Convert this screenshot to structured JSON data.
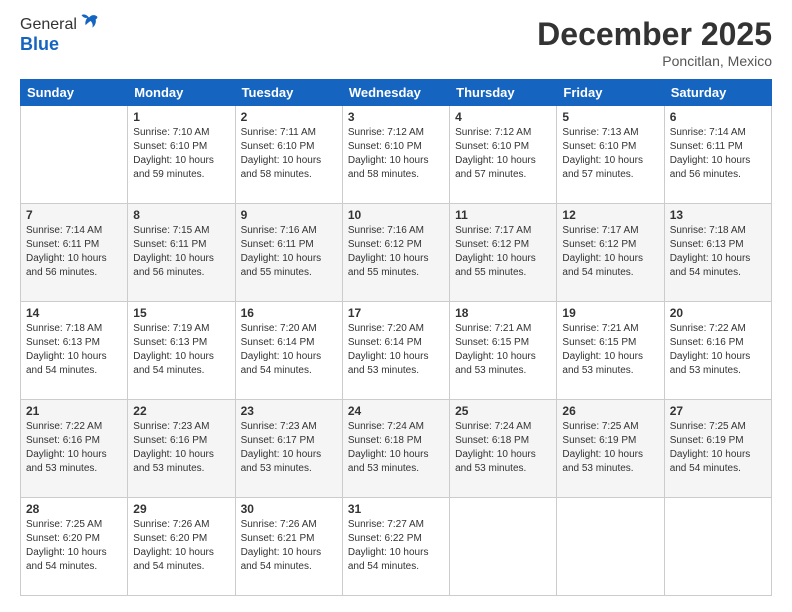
{
  "logo": {
    "general": "General",
    "blue": "Blue"
  },
  "header": {
    "month": "December 2025",
    "location": "Poncitlan, Mexico"
  },
  "days": [
    "Sunday",
    "Monday",
    "Tuesday",
    "Wednesday",
    "Thursday",
    "Friday",
    "Saturday"
  ],
  "weeks": [
    [
      {
        "day": "",
        "info": ""
      },
      {
        "day": "1",
        "info": "Sunrise: 7:10 AM\nSunset: 6:10 PM\nDaylight: 10 hours\nand 59 minutes."
      },
      {
        "day": "2",
        "info": "Sunrise: 7:11 AM\nSunset: 6:10 PM\nDaylight: 10 hours\nand 58 minutes."
      },
      {
        "day": "3",
        "info": "Sunrise: 7:12 AM\nSunset: 6:10 PM\nDaylight: 10 hours\nand 58 minutes."
      },
      {
        "day": "4",
        "info": "Sunrise: 7:12 AM\nSunset: 6:10 PM\nDaylight: 10 hours\nand 57 minutes."
      },
      {
        "day": "5",
        "info": "Sunrise: 7:13 AM\nSunset: 6:10 PM\nDaylight: 10 hours\nand 57 minutes."
      },
      {
        "day": "6",
        "info": "Sunrise: 7:14 AM\nSunset: 6:11 PM\nDaylight: 10 hours\nand 56 minutes."
      }
    ],
    [
      {
        "day": "7",
        "info": "Sunrise: 7:14 AM\nSunset: 6:11 PM\nDaylight: 10 hours\nand 56 minutes."
      },
      {
        "day": "8",
        "info": "Sunrise: 7:15 AM\nSunset: 6:11 PM\nDaylight: 10 hours\nand 56 minutes."
      },
      {
        "day": "9",
        "info": "Sunrise: 7:16 AM\nSunset: 6:11 PM\nDaylight: 10 hours\nand 55 minutes."
      },
      {
        "day": "10",
        "info": "Sunrise: 7:16 AM\nSunset: 6:12 PM\nDaylight: 10 hours\nand 55 minutes."
      },
      {
        "day": "11",
        "info": "Sunrise: 7:17 AM\nSunset: 6:12 PM\nDaylight: 10 hours\nand 55 minutes."
      },
      {
        "day": "12",
        "info": "Sunrise: 7:17 AM\nSunset: 6:12 PM\nDaylight: 10 hours\nand 54 minutes."
      },
      {
        "day": "13",
        "info": "Sunrise: 7:18 AM\nSunset: 6:13 PM\nDaylight: 10 hours\nand 54 minutes."
      }
    ],
    [
      {
        "day": "14",
        "info": "Sunrise: 7:18 AM\nSunset: 6:13 PM\nDaylight: 10 hours\nand 54 minutes."
      },
      {
        "day": "15",
        "info": "Sunrise: 7:19 AM\nSunset: 6:13 PM\nDaylight: 10 hours\nand 54 minutes."
      },
      {
        "day": "16",
        "info": "Sunrise: 7:20 AM\nSunset: 6:14 PM\nDaylight: 10 hours\nand 54 minutes."
      },
      {
        "day": "17",
        "info": "Sunrise: 7:20 AM\nSunset: 6:14 PM\nDaylight: 10 hours\nand 53 minutes."
      },
      {
        "day": "18",
        "info": "Sunrise: 7:21 AM\nSunset: 6:15 PM\nDaylight: 10 hours\nand 53 minutes."
      },
      {
        "day": "19",
        "info": "Sunrise: 7:21 AM\nSunset: 6:15 PM\nDaylight: 10 hours\nand 53 minutes."
      },
      {
        "day": "20",
        "info": "Sunrise: 7:22 AM\nSunset: 6:16 PM\nDaylight: 10 hours\nand 53 minutes."
      }
    ],
    [
      {
        "day": "21",
        "info": "Sunrise: 7:22 AM\nSunset: 6:16 PM\nDaylight: 10 hours\nand 53 minutes."
      },
      {
        "day": "22",
        "info": "Sunrise: 7:23 AM\nSunset: 6:16 PM\nDaylight: 10 hours\nand 53 minutes."
      },
      {
        "day": "23",
        "info": "Sunrise: 7:23 AM\nSunset: 6:17 PM\nDaylight: 10 hours\nand 53 minutes."
      },
      {
        "day": "24",
        "info": "Sunrise: 7:24 AM\nSunset: 6:18 PM\nDaylight: 10 hours\nand 53 minutes."
      },
      {
        "day": "25",
        "info": "Sunrise: 7:24 AM\nSunset: 6:18 PM\nDaylight: 10 hours\nand 53 minutes."
      },
      {
        "day": "26",
        "info": "Sunrise: 7:25 AM\nSunset: 6:19 PM\nDaylight: 10 hours\nand 53 minutes."
      },
      {
        "day": "27",
        "info": "Sunrise: 7:25 AM\nSunset: 6:19 PM\nDaylight: 10 hours\nand 54 minutes."
      }
    ],
    [
      {
        "day": "28",
        "info": "Sunrise: 7:25 AM\nSunset: 6:20 PM\nDaylight: 10 hours\nand 54 minutes."
      },
      {
        "day": "29",
        "info": "Sunrise: 7:26 AM\nSunset: 6:20 PM\nDaylight: 10 hours\nand 54 minutes."
      },
      {
        "day": "30",
        "info": "Sunrise: 7:26 AM\nSunset: 6:21 PM\nDaylight: 10 hours\nand 54 minutes."
      },
      {
        "day": "31",
        "info": "Sunrise: 7:27 AM\nSunset: 6:22 PM\nDaylight: 10 hours\nand 54 minutes."
      },
      {
        "day": "",
        "info": ""
      },
      {
        "day": "",
        "info": ""
      },
      {
        "day": "",
        "info": ""
      }
    ]
  ]
}
